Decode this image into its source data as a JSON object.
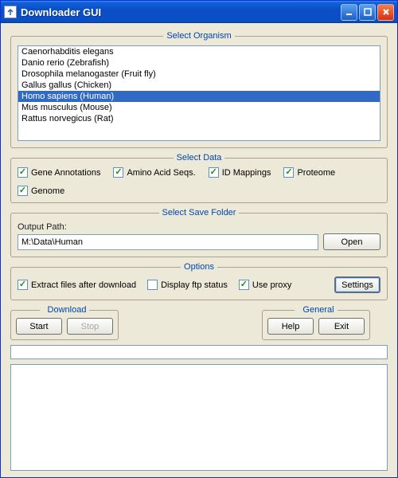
{
  "window": {
    "title": "Downloader GUI"
  },
  "organism": {
    "legend": "Select Organism",
    "items": [
      "Caenorhabditis elegans",
      "Danio rerio (Zebrafish)",
      "Drosophila melanogaster (Fruit fly)",
      "Gallus gallus (Chicken)",
      "Homo sapiens (Human)",
      "Mus musculus (Mouse)",
      "Rattus norvegicus (Rat)"
    ],
    "selected_index": 4
  },
  "data": {
    "legend": "Select Data",
    "checks": [
      {
        "label": "Gene Annotations",
        "checked": true
      },
      {
        "label": "Amino Acid Seqs.",
        "checked": true
      },
      {
        "label": "ID Mappings",
        "checked": true
      },
      {
        "label": "Proteome",
        "checked": true
      },
      {
        "label": "Genome",
        "checked": true
      }
    ]
  },
  "savefolder": {
    "legend": "Select Save Folder",
    "path_label": "Output Path:",
    "path_value": "M:\\Data\\Human",
    "open_label": "Open"
  },
  "options": {
    "legend": "Options",
    "extract": {
      "label": "Extract files after download",
      "checked": true
    },
    "display_ftp": {
      "label": "Display ftp status",
      "checked": false
    },
    "use_proxy": {
      "label": "Use proxy",
      "checked": true
    },
    "settings_label": "Settings"
  },
  "download": {
    "legend": "Download",
    "start_label": "Start",
    "stop_label": "Stop"
  },
  "general": {
    "legend": "General",
    "help_label": "Help",
    "exit_label": "Exit"
  }
}
